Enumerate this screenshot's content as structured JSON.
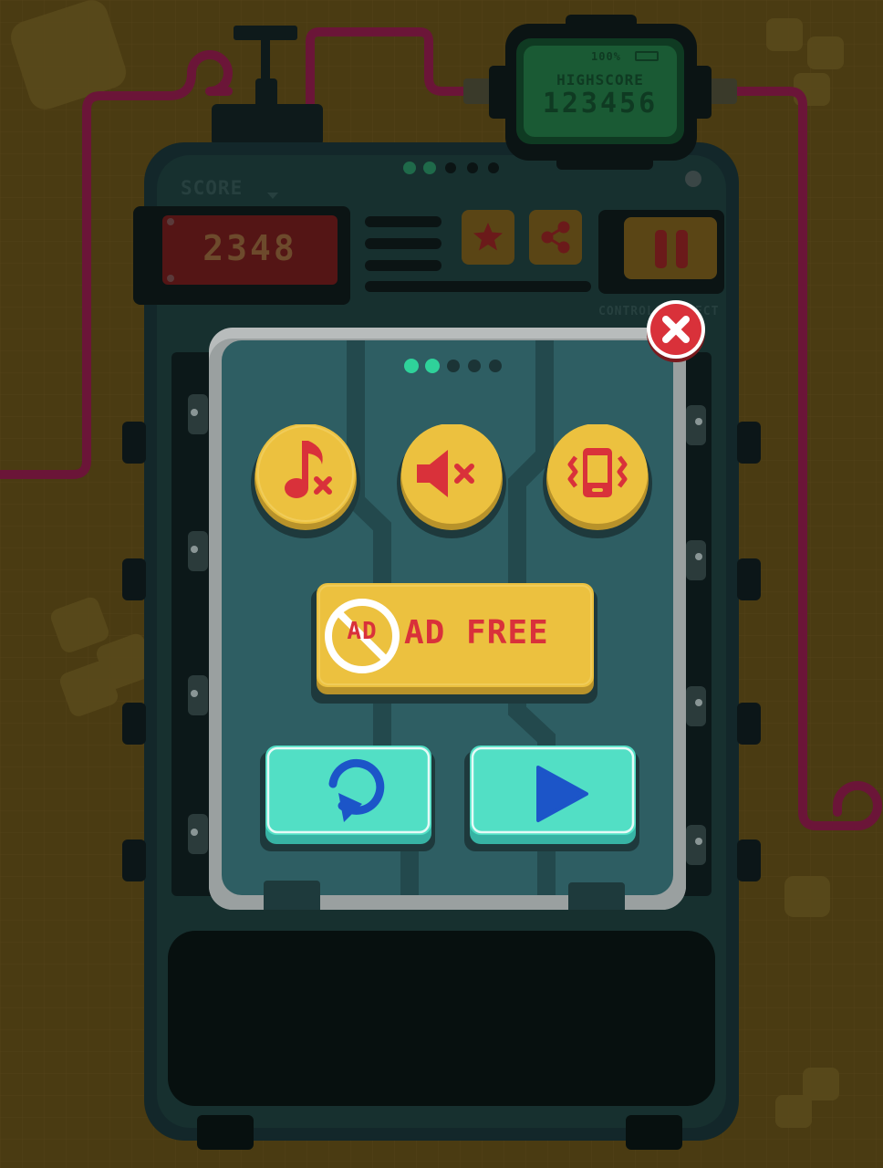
{
  "highscore": {
    "battery": "100%",
    "label": "HIGHSCORE",
    "value": "123456"
  },
  "score": {
    "label": "SCORE",
    "value": "2348"
  },
  "controls_label": "CONTROLS SELECT",
  "popup": {
    "page_dots": {
      "total": 5,
      "active": 2
    },
    "ad_free": {
      "badge": "AD",
      "label": "AD FREE"
    }
  },
  "machine_dots": {
    "total": 5,
    "active": 2
  },
  "icons": {
    "music_off": "music-off-icon",
    "sound_off": "sound-off-icon",
    "vibration": "vibration-icon",
    "restart": "restart-icon",
    "play": "play-icon",
    "close": "close-icon",
    "star": "star-icon",
    "share": "share-icon",
    "pause": "pause-icon"
  },
  "colors": {
    "background": "#4a3b12",
    "cable": "#6b1538",
    "yellow_button": "#ecc13f",
    "red_icon": "#d9313a",
    "teal_button": "#52dfc5",
    "blue_icon": "#1c55c8",
    "popup_panel": "#2e5e63",
    "lcd_green": "#1f6f3e",
    "lcd_red": "#6b1a1a",
    "dot_active": "#2fd29a"
  }
}
